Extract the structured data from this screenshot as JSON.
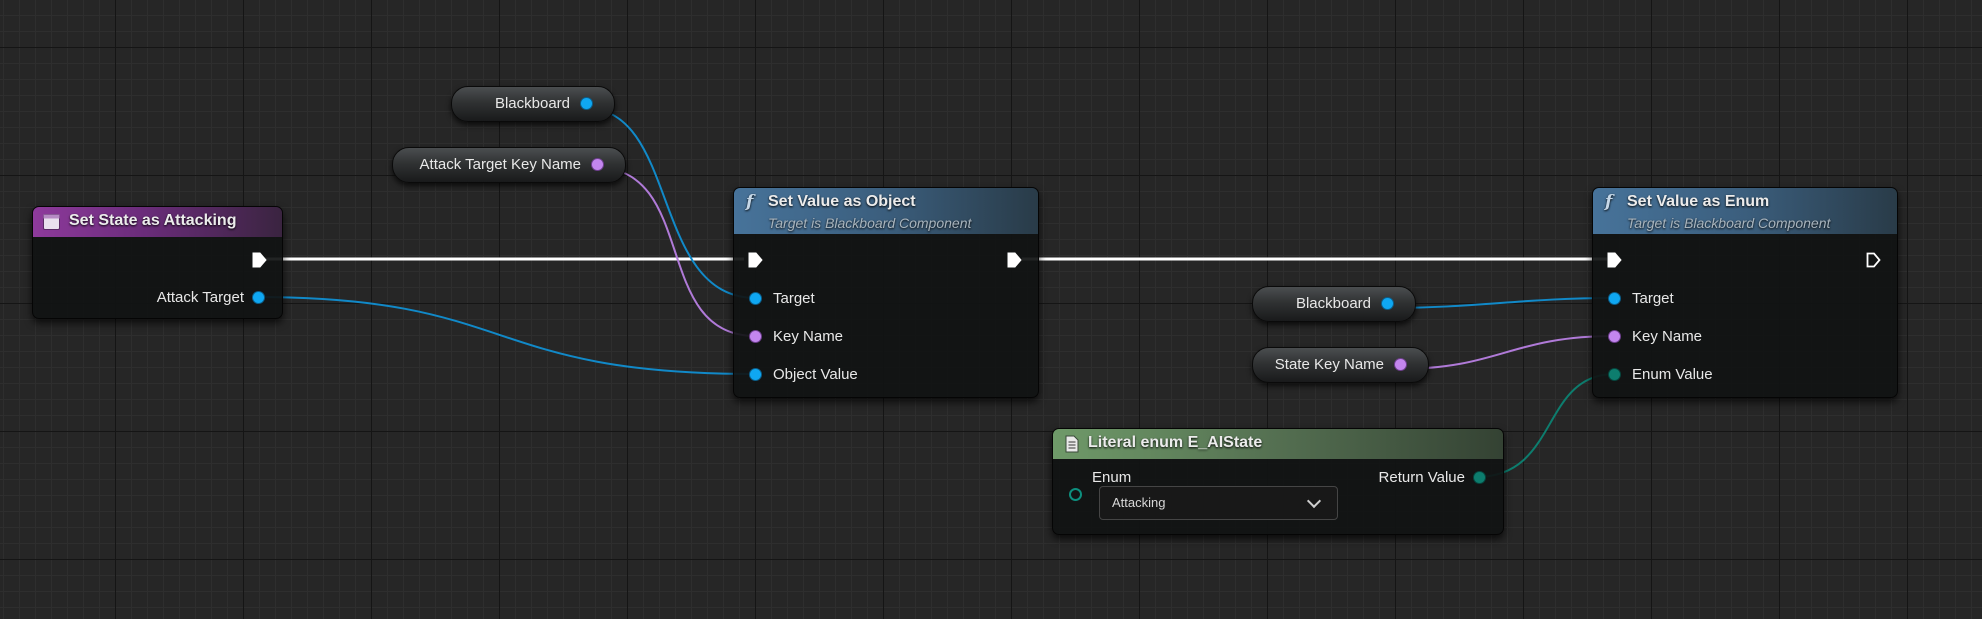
{
  "nodes": {
    "event": {
      "title": "Set State as Attacking",
      "output_pin": "Attack Target"
    },
    "set_object": {
      "title": "Set Value as Object",
      "subtitle": "Target is Blackboard Component",
      "pins": [
        "Target",
        "Key Name",
        "Object Value"
      ]
    },
    "set_enum": {
      "title": "Set Value as Enum",
      "subtitle": "Target is Blackboard Component",
      "pins": [
        "Target",
        "Key Name",
        "Enum Value"
      ]
    },
    "literal_enum": {
      "title": "Literal enum E_AIState",
      "input_label": "Enum",
      "output_label": "Return Value",
      "selected_value": "Attacking"
    }
  },
  "getters": {
    "blackboard_1": "Blackboard",
    "attack_key": "Attack Target Key Name",
    "blackboard_2": "Blackboard",
    "state_key": "State Key Name"
  },
  "colors": {
    "object_pin": "#0fa7f2",
    "name_pin": "#c386ee",
    "enum_pin": "#0d7d6e",
    "event_header": "#8e3a9c",
    "function_header": "#47739a",
    "literal_header": "#6f9a69"
  },
  "icons": {
    "event": "event-node-icon",
    "function": "function-f-icon",
    "literal": "literal-doc-icon",
    "dropdown": "chevron-down-icon"
  }
}
